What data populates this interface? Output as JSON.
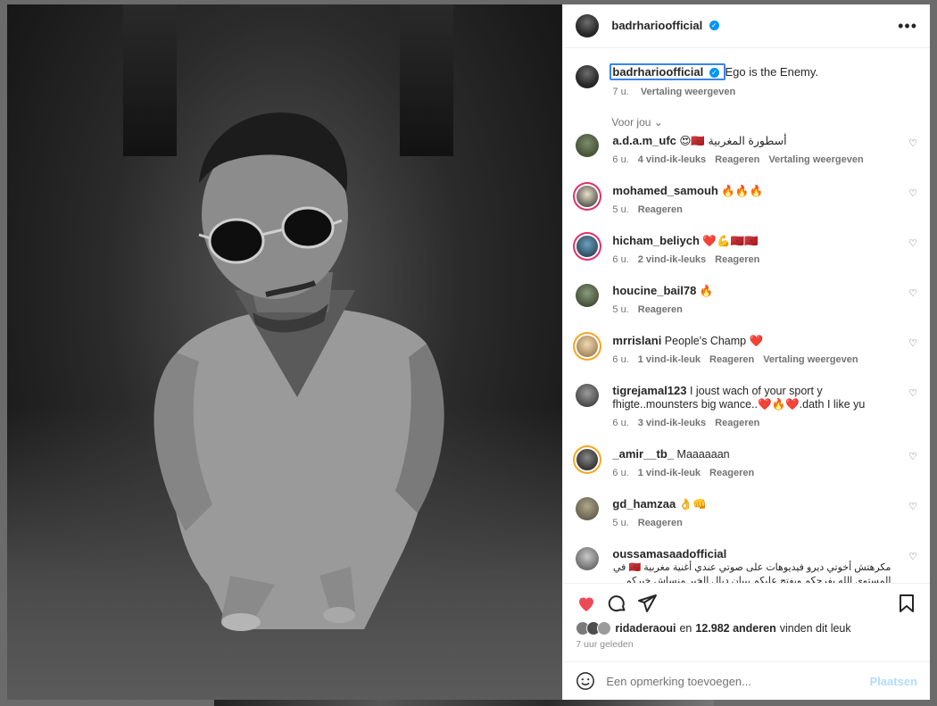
{
  "post": {
    "author": "badrharioofficial_placeholder"
  },
  "header": {
    "username": "badrharioofficial",
    "more_label": "•••"
  },
  "caption": {
    "username": "badrharioofficial",
    "text": "Ego is the Enemy.",
    "time": "7 u.",
    "translate": "Vertaling weergeven"
  },
  "foryou": "Voor jou",
  "comments": [
    {
      "user": "a.d.a.m_ufc",
      "text": "😍🇲🇦 أسطورة المغربية",
      "time": "6 u.",
      "likes": "4 vind-ik-leuks",
      "reply": "Reageren",
      "translate": "Vertaling weergeven"
    },
    {
      "user": "mohamed_samouh",
      "text": "🔥🔥🔥",
      "time": "5 u.",
      "likes": "",
      "reply": "Reageren",
      "translate": ""
    },
    {
      "user": "hicham_beliych",
      "text": "❤️💪🇲🇦🇲🇦",
      "time": "6 u.",
      "likes": "2 vind-ik-leuks",
      "reply": "Reageren",
      "translate": ""
    },
    {
      "user": "houcine_bail78",
      "text": "🔥",
      "time": "5 u.",
      "likes": "",
      "reply": "Reageren",
      "translate": ""
    },
    {
      "user": "mrrislani",
      "text": "People's Champ ❤️",
      "time": "6 u.",
      "likes": "1 vind-ik-leuk",
      "reply": "Reageren",
      "translate": "Vertaling weergeven"
    },
    {
      "user": "tigrejamal123",
      "text": "I joust wach of your sport y fhigte..mounsters big wance..❤️🔥❤️.dath I like yu",
      "time": "6 u.",
      "likes": "3 vind-ik-leuks",
      "reply": "Reageren",
      "translate": ""
    },
    {
      "user": "_amir__tb_",
      "text": "Maaaaaan",
      "time": "6 u.",
      "likes": "1 vind-ik-leuk",
      "reply": "Reageren",
      "translate": ""
    },
    {
      "user": "gd_hamzaa",
      "text": "👌👊",
      "time": "5 u.",
      "likes": "",
      "reply": "Reageren",
      "translate": ""
    },
    {
      "user": "oussamasaadofficial",
      "text": "مكرهتش أخوتي ديرو فيديوهات على صوتي عندي أغنية مغربية 🇲🇦 في المستوى الله يفرحكم ويفتح عليكم ببيان ديال الخير منساش خيركم والله ربي يسهل عليكم ماصعب👏 طلعو تعليق ديالي الله يرحم الوالدين ❤️😂",
      "time": "",
      "likes": "",
      "reply": "",
      "translate": ""
    }
  ],
  "likes_line": {
    "user": "ridaderaoui",
    "connector": "en",
    "count": "12.982 anderen",
    "suffix": "vinden dit leuk"
  },
  "posted_ago": "7 uur geleden",
  "add_comment": {
    "placeholder": "Een opmerking toevoegen...",
    "post_label": "Plaatsen"
  },
  "colors": {
    "accent": "#0095f6",
    "like_red": "#ed4956"
  }
}
